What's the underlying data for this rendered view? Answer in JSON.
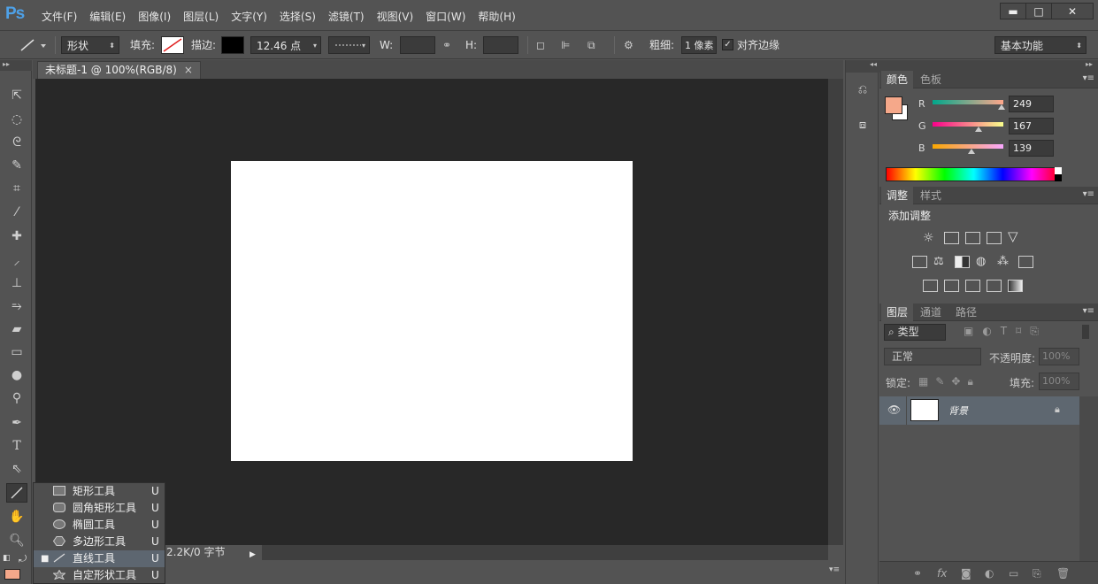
{
  "app": {
    "logo": "Ps"
  },
  "menu": [
    "文件(F)",
    "编辑(E)",
    "图像(I)",
    "图层(L)",
    "文字(Y)",
    "选择(S)",
    "滤镜(T)",
    "视图(V)",
    "窗口(W)",
    "帮助(H)"
  ],
  "window_controls": {
    "minimize": "▬",
    "maximize": "□",
    "close": "✕"
  },
  "options": {
    "mode": "形状",
    "fill_label": "填充:",
    "stroke_label": "描边:",
    "stroke_width": "12.46 点",
    "w_label": "W:",
    "h_label": "H:",
    "weight_label": "粗细:",
    "weight_value": "1 像素",
    "align_edges": "对齐边缘",
    "workspace": "基本功能"
  },
  "document": {
    "tab_title": "未标题-1 @ 100%(RGB/8)",
    "tab_close": "×",
    "status": "2.2K/0 字节"
  },
  "flyout": {
    "items": [
      {
        "label": "矩形工具",
        "key": "U",
        "icon": "rectangle-icon",
        "selected": false
      },
      {
        "label": "圆角矩形工具",
        "key": "U",
        "icon": "rounded-rectangle-icon",
        "selected": false
      },
      {
        "label": "椭圆工具",
        "key": "U",
        "icon": "ellipse-icon",
        "selected": false
      },
      {
        "label": "多边形工具",
        "key": "U",
        "icon": "polygon-icon",
        "selected": false
      },
      {
        "label": "直线工具",
        "key": "U",
        "icon": "line-icon",
        "selected": true
      },
      {
        "label": "自定形状工具",
        "key": "U",
        "icon": "custom-shape-icon",
        "selected": false
      }
    ]
  },
  "panels": {
    "color": {
      "tabs": [
        "颜色",
        "色板"
      ],
      "foreground": "#f5a88a",
      "r_label": "R",
      "r": "249",
      "g_label": "G",
      "g": "167",
      "b_label": "B",
      "b": "139"
    },
    "adjustments": {
      "tabs": [
        "调整",
        "样式"
      ],
      "title": "添加调整"
    },
    "layers": {
      "tabs": [
        "图层",
        "通道",
        "路径"
      ],
      "kind": "类型",
      "blend": "正常",
      "opacity_label": "不透明度:",
      "opacity": "100%",
      "lock_label": "锁定:",
      "fill_label": "填充:",
      "fill": "100%",
      "layer_name": "背景"
    }
  },
  "colors": {
    "accent": "#4ea1e8",
    "canvas_bg": "#282828",
    "panel_bg": "#535353"
  }
}
